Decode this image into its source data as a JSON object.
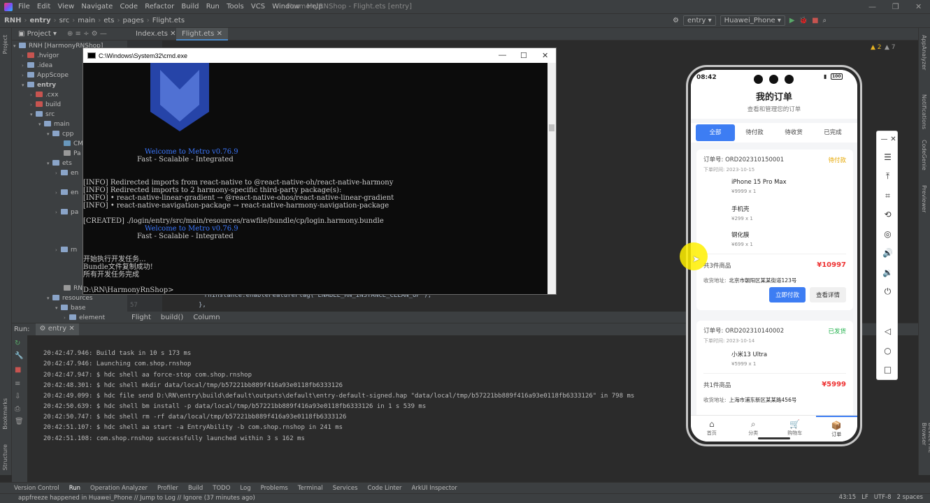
{
  "app": {
    "window_title": "HarmonyRNShop - Flight.ets [entry]",
    "menu": [
      "File",
      "Edit",
      "View",
      "Navigate",
      "Code",
      "Refactor",
      "Build",
      "Run",
      "Tools",
      "VCS",
      "Window",
      "Help"
    ]
  },
  "breadcrumb": [
    "RNH",
    "entry",
    "src",
    "main",
    "ets",
    "pages",
    "Flight.ets"
  ],
  "run_config": "entry",
  "device": "Huawei_Phone",
  "editor_tabs": [
    "Index.ets",
    "Flight.ets"
  ],
  "project_panel": {
    "label": "Project",
    "root": "RNH [HarmonyRNShop]",
    "tree": [
      ".hvigor",
      ".idea",
      "AppScope",
      "entry",
      ".cxx",
      "build",
      "src",
      "main",
      "cpp",
      "CM",
      "Pa",
      "ets",
      "en",
      "en",
      "pa",
      "rn",
      "RN",
      "resources",
      "base",
      "element"
    ]
  },
  "editor": {
    "code_line_1": "rnInstance.enableFeatureFlag('ENABLE_RN_INSTANCE_CLEAN_UP');",
    "code_line_2": "},",
    "line_number": "57",
    "warnings": "2",
    "weak_warnings": "7",
    "status_crumbs": [
      "Flight",
      "build()",
      "Column"
    ]
  },
  "run_panel": {
    "label": "Run:",
    "config": "entry",
    "log": [
      "20:42:47.946: Build task in 10 s 173 ms",
      "20:42:47.946: Launching com.shop.rnshop",
      "20:42:47.947: $ hdc shell aa force-stop com.shop.rnshop",
      "20:42:48.301: $ hdc shell mkdir data/local/tmp/b57221bb889f416a93e0118fb6333126",
      "20:42:49.099: $ hdc file send D:\\RN\\entry\\build\\default\\outputs\\default\\entry-default-signed.hap \"data/local/tmp/b57221bb889f416a93e0118fb6333126\" in 798 ms",
      "20:42:50.639: $ hdc shell bm install -p data/local/tmp/b57221bb889f416a93e0118fb6333126  in 1 s 539 ms",
      "20:42:50.747: $ hdc shell rm -rf data/local/tmp/b57221bb889f416a93e0118fb6333126",
      "20:42:51.107: $ hdc shell aa start -a EntryAbility -b com.shop.rnshop in 241 ms",
      "20:42:51.108: com.shop.rnshop successfully launched within 3 s 162 ms"
    ]
  },
  "bottom_tools": [
    "Version Control",
    "Run",
    "Operation Analyzer",
    "Profiler",
    "Build",
    "TODO",
    "Log",
    "Problems",
    "Terminal",
    "Services",
    "Code Linter",
    "ArkUI Inspector"
  ],
  "status": {
    "message": "appfreeze happened in Huawei_Phone // Jump to Log // Ignore (37 minutes ago)",
    "position": "43:15",
    "line_sep": "LF",
    "encoding": "UTF-8",
    "indent": "2 spaces"
  },
  "side_labels": {
    "left": [
      "Project",
      "Bookmarks",
      "Structure"
    ],
    "right": [
      "AppAnalyzer",
      "Notifications",
      "CodeGenie",
      "Previewer",
      "Device File Browser"
    ]
  },
  "cmd": {
    "title": "C:\\Windows\\System32\\cmd.exe",
    "welcome1": "Welcome to Metro v0.76.9",
    "tag1": "Fast - Scalable - Integrated",
    "info1": "[INFO] Redirected imports from react-native to @react-native-oh/react-native-harmony",
    "info2": "[INFO] Redirected imports to 2 harmony-specific third-party package(s):",
    "info3": "[INFO] • react-native-linear-gradient → @react-native-ohos/react-native-linear-gradient",
    "info4": "[INFO] • react-native-navigation-package → react-native-harmony-navigation-package",
    "created": "[CREATED] ./login/entry/src/main/resources/rawfile/bundle/cp/login.harmony.bundle",
    "welcome2": "Welcome to Metro v0.76.9",
    "tag2": "Fast - Scalable - Integrated",
    "cn1": "开始执行开发任务...",
    "cn2": "Bundle文件复制成功!",
    "cn3": "所有开发任务完成",
    "prompt": "D:\\RN\\HarmonyRnShop>"
  },
  "phone": {
    "time": "08:42",
    "battery": "100",
    "title": "我的订单",
    "subtitle": "查看和管理您的订单",
    "tabs": [
      "全部",
      "待付款",
      "待收货",
      "已完成"
    ],
    "orders": [
      {
        "no": "订单号: ORD202310150001",
        "status": "待付款",
        "status_color": "#e6a700",
        "time": "下单时间: 2023-10-15",
        "items": [
          {
            "name": "iPhone 15 Pro Max",
            "price": "¥9999 x 1"
          },
          {
            "name": "手机壳",
            "price": "¥299 x 1"
          },
          {
            "name": "钢化膜",
            "price": "¥699 x 1"
          }
        ],
        "count": "共3件商品",
        "total": "¥10997",
        "addr_label": "收货地址:",
        "addr": "北京市朝阳区某某街道123号",
        "btn_pay": "立即付款",
        "btn_detail": "查看详情"
      },
      {
        "no": "订单号: ORD202310140002",
        "status": "已发货",
        "status_color": "#22b14c",
        "time": "下单时间: 2023-10-14",
        "items": [
          {
            "name": "小米13 Ultra",
            "price": "¥5999 x 1"
          }
        ],
        "count": "共1件商品",
        "total": "¥5999",
        "addr_label": "收货地址:",
        "addr": "上海市浦东新区某某路456号"
      }
    ],
    "nav": [
      "首页",
      "分类",
      "购物车",
      "订单"
    ]
  }
}
